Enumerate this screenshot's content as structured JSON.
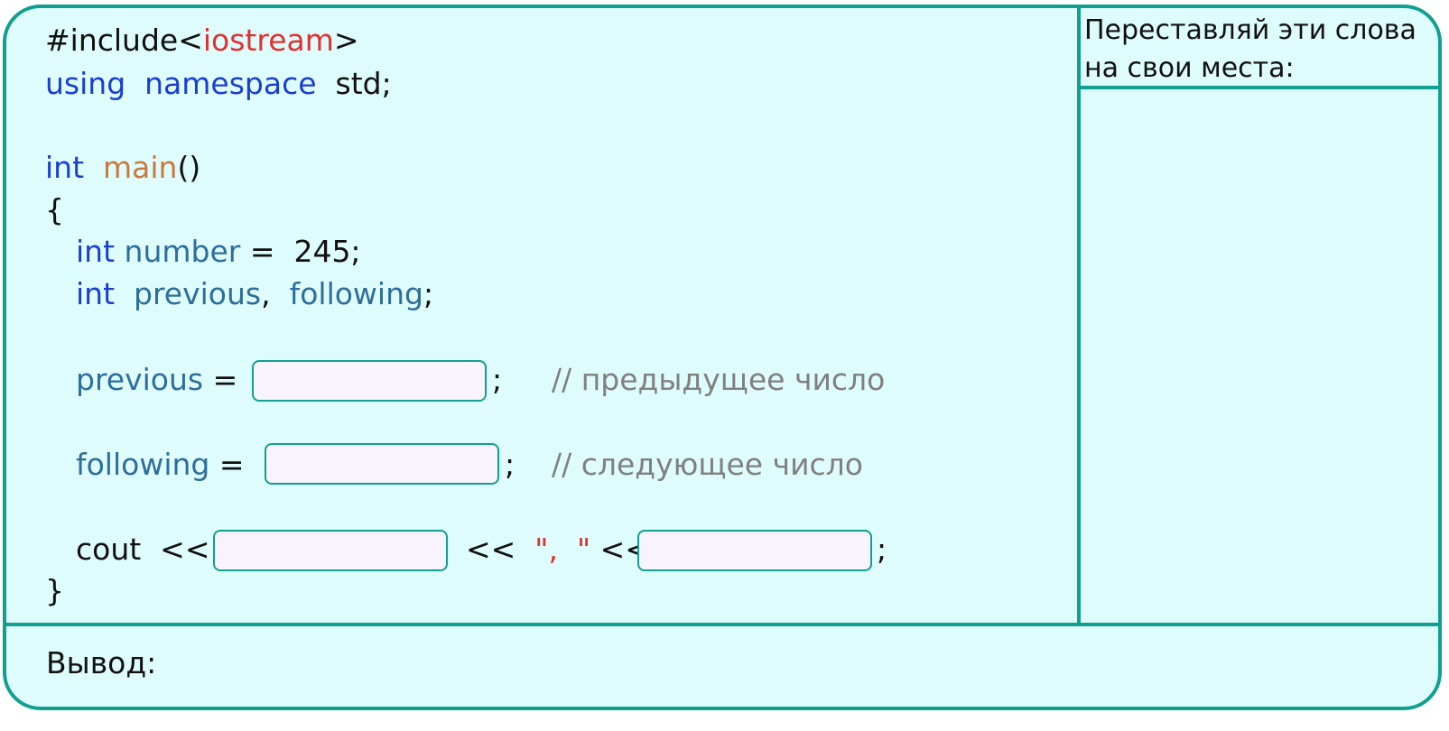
{
  "code": {
    "include_hash": "#include",
    "include_lt": "<",
    "include_lib": "iostream",
    "include_gt": ">",
    "using_kw": "using",
    "namespace_kw": "namespace",
    "std": "std;",
    "main_type": "int",
    "main_name": "main",
    "main_parens": "()",
    "open_brace": "{",
    "l1_type": "int",
    "l1_var": "number",
    "l1_rest": " =  245;",
    "l2_type": "int",
    "l2_var1": "previous",
    "l2_comma": ",",
    "l2_var2": "following",
    "l2_semi": ";",
    "prev_var": "previous",
    "prev_eq": " =",
    "prev_semi": ";",
    "prev_comment": "// предыдущее число",
    "foll_var": "following",
    "foll_eq": " =",
    "foll_semi": ";",
    "foll_comment": "// следующее число",
    "cout_kw": "cout",
    "cout_op1": "<<",
    "cout_op2": "<<",
    "cout_str_a": "\",",
    "cout_str_b": "\"",
    "cout_op3": "<<",
    "cout_semi": ";",
    "close_brace": "}"
  },
  "sidebar": {
    "instruction": "Переставляй эти слова на свои места:"
  },
  "output": {
    "label": "Вывод:"
  },
  "colors": {
    "border": "#10a090",
    "background": "#dffcfc",
    "blank_fill": "#f8f3fd",
    "keyword": "#1a3fd0",
    "identifier": "#2e6e9c",
    "function": "#c77a40",
    "string": "#e03030",
    "comment": "#808080"
  }
}
